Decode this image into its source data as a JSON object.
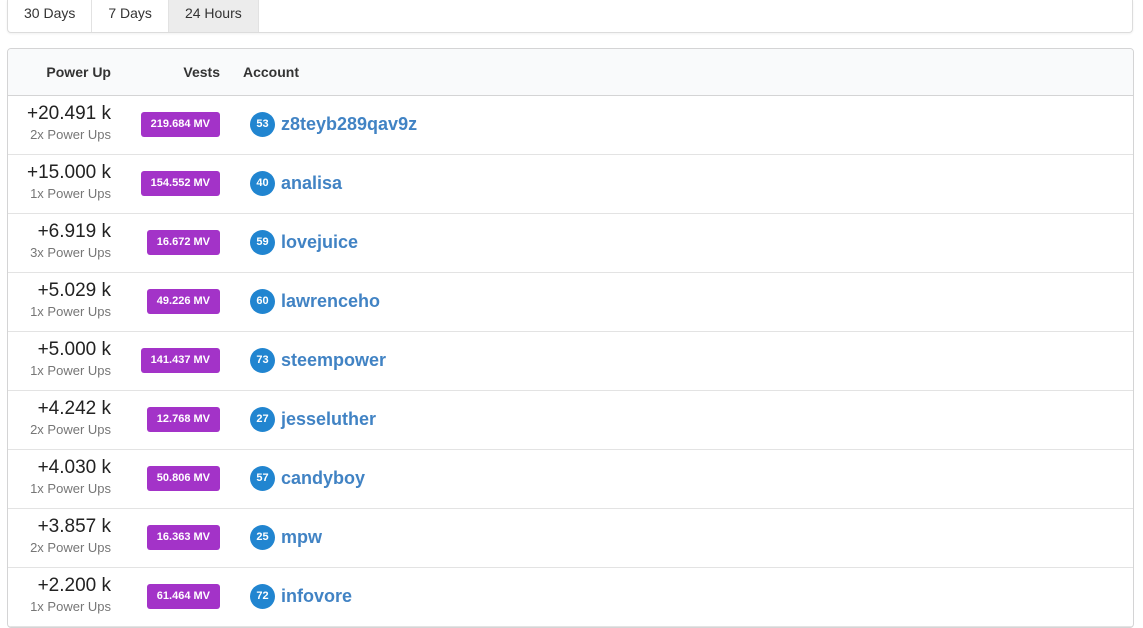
{
  "tabs": [
    {
      "label": "30 Days",
      "active": false
    },
    {
      "label": "7 Days",
      "active": false
    },
    {
      "label": "24 Hours",
      "active": true
    }
  ],
  "table": {
    "headers": {
      "power_up": "Power Up",
      "vests": "Vests",
      "account": "Account"
    },
    "rows": [
      {
        "amount": "+20.491 k",
        "count": "2x Power Ups",
        "vests": "219.684 MV",
        "rep": "53",
        "account": "z8teyb289qav9z"
      },
      {
        "amount": "+15.000 k",
        "count": "1x Power Ups",
        "vests": "154.552 MV",
        "rep": "40",
        "account": "analisa"
      },
      {
        "amount": "+6.919 k",
        "count": "3x Power Ups",
        "vests": "16.672 MV",
        "rep": "59",
        "account": "lovejuice"
      },
      {
        "amount": "+5.029 k",
        "count": "1x Power Ups",
        "vests": "49.226 MV",
        "rep": "60",
        "account": "lawrenceho"
      },
      {
        "amount": "+5.000 k",
        "count": "1x Power Ups",
        "vests": "141.437 MV",
        "rep": "73",
        "account": "steempower"
      },
      {
        "amount": "+4.242 k",
        "count": "2x Power Ups",
        "vests": "12.768 MV",
        "rep": "27",
        "account": "jesseluther"
      },
      {
        "amount": "+4.030 k",
        "count": "1x Power Ups",
        "vests": "50.806 MV",
        "rep": "57",
        "account": "candyboy"
      },
      {
        "amount": "+3.857 k",
        "count": "2x Power Ups",
        "vests": "16.363 MV",
        "rep": "25",
        "account": "mpw"
      },
      {
        "amount": "+2.200 k",
        "count": "1x Power Ups",
        "vests": "61.464 MV",
        "rep": "72",
        "account": "infovore"
      }
    ]
  },
  "colors": {
    "vests_label": "#a333c8",
    "rep_badge": "#2185d0",
    "account_link": "#4183c4"
  }
}
